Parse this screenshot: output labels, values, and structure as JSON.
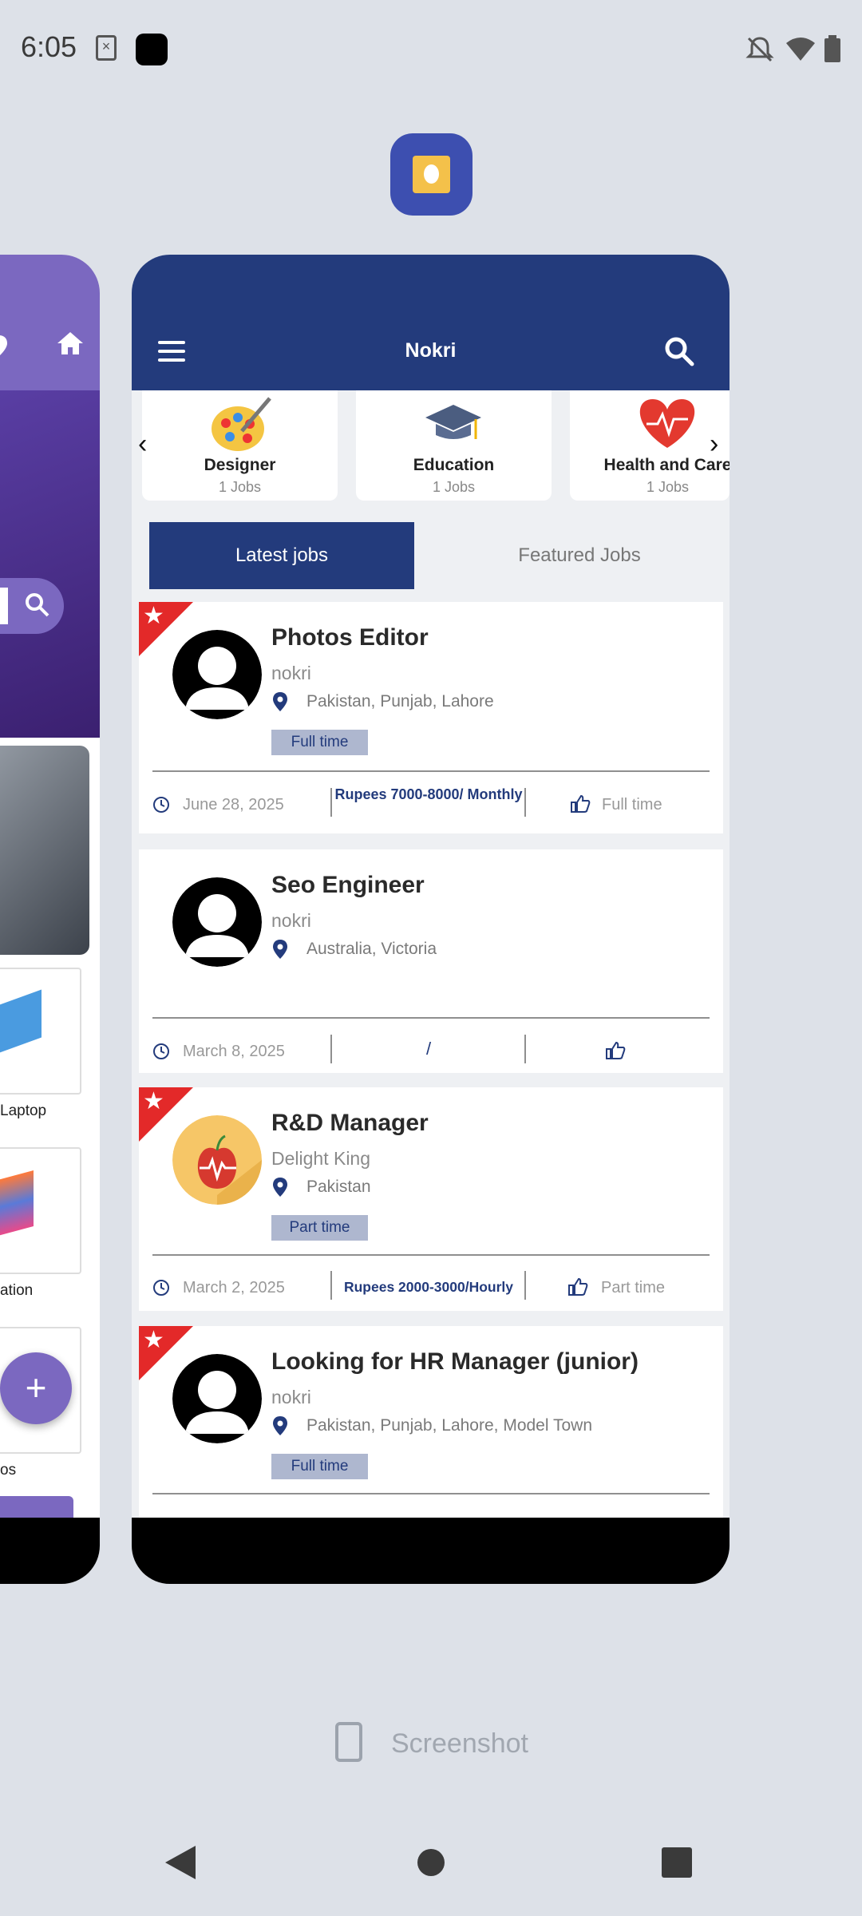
{
  "status_bar": {
    "time": "6:05"
  },
  "app": {
    "title": "Nokri"
  },
  "categories": [
    {
      "name": "Designer",
      "count": "1 Jobs"
    },
    {
      "name": "Education",
      "count": "1 Jobs"
    },
    {
      "name": "Health and Care",
      "count": "1 Jobs"
    }
  ],
  "tabs": {
    "latest": "Latest jobs",
    "featured": "Featured Jobs"
  },
  "jobs": [
    {
      "title": "Photos Editor",
      "company": "nokri",
      "location": "Pakistan, Punjab, Lahore",
      "badge": "Full time",
      "date": "June 28, 2025",
      "salary": "Rupees 7000-8000/ Monthly",
      "job_type": "Full time",
      "featured": true
    },
    {
      "title": "Seo Engineer",
      "company": "nokri",
      "location": "Australia, Victoria",
      "badge": "",
      "date": "March 8, 2025",
      "salary": "/",
      "job_type": "",
      "featured": false
    },
    {
      "title": "R&D Manager",
      "company": "Delight King",
      "location": "Pakistan",
      "badge": "Part time",
      "date": "March 2, 2025",
      "salary": "Rupees 2000-3000/Hourly",
      "job_type": "Part time",
      "featured": true
    },
    {
      "title": "Looking for HR Manager (junior)",
      "company": "nokri",
      "location": "Pakistan, Punjab, Lahore, Model Town",
      "badge": "Full time",
      "featured": true
    }
  ],
  "left_app": {
    "labels": [
      "Laptop",
      "ation",
      "os"
    ]
  },
  "recents": {
    "screenshot_label": "Screenshot"
  },
  "colors": {
    "primary": "#233b7c",
    "accent": "#7b68c0",
    "ribbon": "#e32929",
    "badge_bg": "#aeb7cf"
  }
}
